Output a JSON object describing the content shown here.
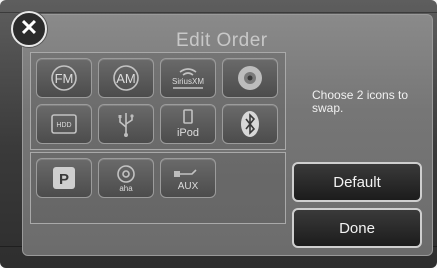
{
  "screen": {
    "title": "Edit Order",
    "hint": "Choose 2 icons to swap.",
    "close_icon": "close-x-icon"
  },
  "source_icons": [
    {
      "id": "fm",
      "label": "FM",
      "icon": "fm-radio-icon"
    },
    {
      "id": "am",
      "label": "AM",
      "icon": "am-radio-icon"
    },
    {
      "id": "siriusxm",
      "label": "SiriusXM",
      "icon": "siriusxm-icon"
    },
    {
      "id": "disc",
      "label": "",
      "icon": "disc-icon"
    },
    {
      "id": "hdd",
      "label": "HDD",
      "icon": "hdd-icon"
    },
    {
      "id": "usb",
      "label": "",
      "icon": "usb-icon"
    },
    {
      "id": "ipod",
      "label": "iPod",
      "icon": "ipod-icon"
    },
    {
      "id": "bluetooth",
      "label": "",
      "icon": "bluetooth-icon"
    }
  ],
  "extra_icons": [
    {
      "id": "pandora",
      "label": "P",
      "icon": "pandora-icon"
    },
    {
      "id": "aha",
      "label": "aha",
      "icon": "aha-icon"
    },
    {
      "id": "aux",
      "label": "AUX",
      "icon": "aux-icon"
    }
  ],
  "buttons": {
    "default_label": "Default",
    "done_label": "Done"
  }
}
